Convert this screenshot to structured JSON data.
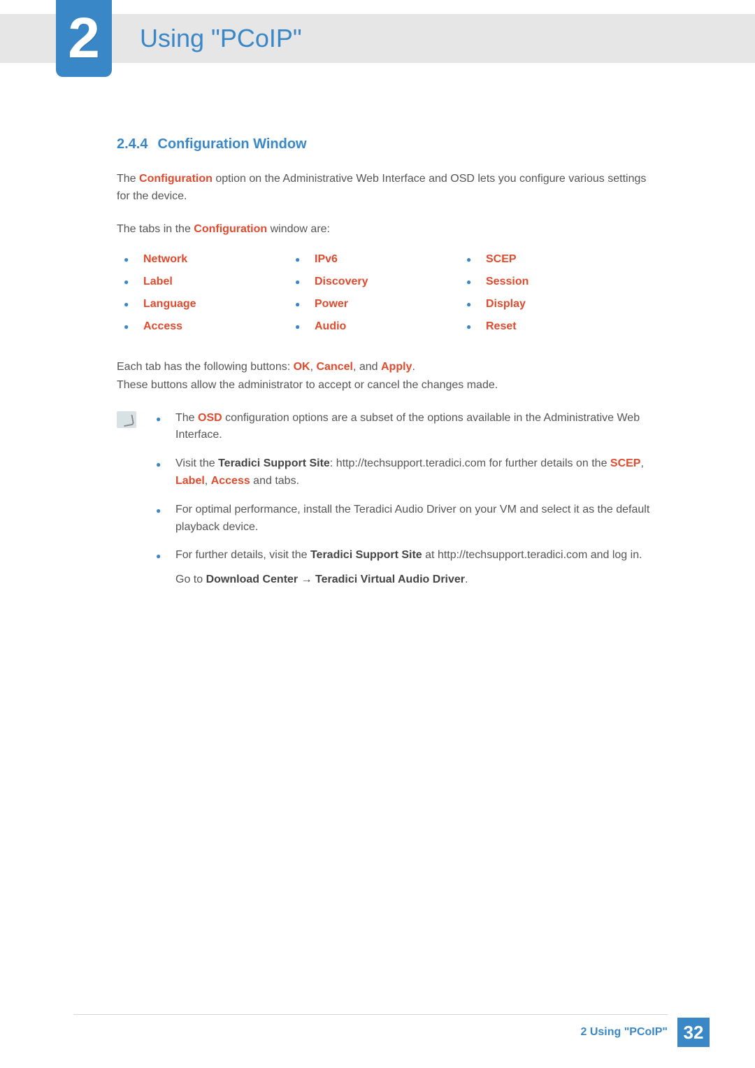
{
  "header": {
    "chapter_number": "2",
    "title": "Using \"PCoIP\""
  },
  "section": {
    "number": "2.4.4",
    "title": "Configuration Window"
  },
  "intro": {
    "p1_before": "The ",
    "p1_bold": "Configuration",
    "p1_after": " option on the Administrative Web Interface and OSD lets you configure various settings for the device.",
    "p2_before": "The tabs in the ",
    "p2_bold": "Configuration",
    "p2_after": " window are:"
  },
  "tabs": {
    "col1": [
      "Network",
      "Label",
      "Language",
      "Access"
    ],
    "col2": [
      "IPv6",
      "Discovery",
      "Power",
      "Audio"
    ],
    "col3": [
      "SCEP",
      "Session",
      "Display",
      "Reset"
    ]
  },
  "buttons_para": {
    "line1_before": "Each tab has the following buttons: ",
    "b1": "OK",
    "sep1": ", ",
    "b2": "Cancel",
    "sep2": ", and ",
    "b3": "Apply",
    "line1_after": ".",
    "line2": "These buttons allow the administrator to accept or cancel the changes made."
  },
  "notes": {
    "n1_before": "The ",
    "n1_bold": "OSD",
    "n1_after": " configuration options are a subset of the options available in the Administrative Web Interface.",
    "n2_before": "Visit the ",
    "n2_bold1": "Teradici Support Site",
    "n2_mid": ": http://techsupport.teradici.com for further details on the ",
    "n2_red1": "SCEP",
    "n2_c1": ", ",
    "n2_red2": "Label",
    "n2_c2": ",  ",
    "n2_red3": "Access",
    "n2_after": " and tabs.",
    "n3": "For optimal performance, install the Teradici Audio Driver on your VM and select it as the default playback device.",
    "n4_before": "For further details, visit the ",
    "n4_bold1": "Teradici Support Site",
    "n4_mid": " at http://techsupport.teradici.com and log in.",
    "n4_sub_before": "Go to ",
    "n4_sub_bold1": "Download Center",
    "n4_arrow": " → ",
    "n4_sub_bold2": "Teradici Virtual Audio Driver",
    "n4_sub_after": "."
  },
  "footer": {
    "text": "2 Using \"PCoIP\"",
    "page": "32"
  }
}
